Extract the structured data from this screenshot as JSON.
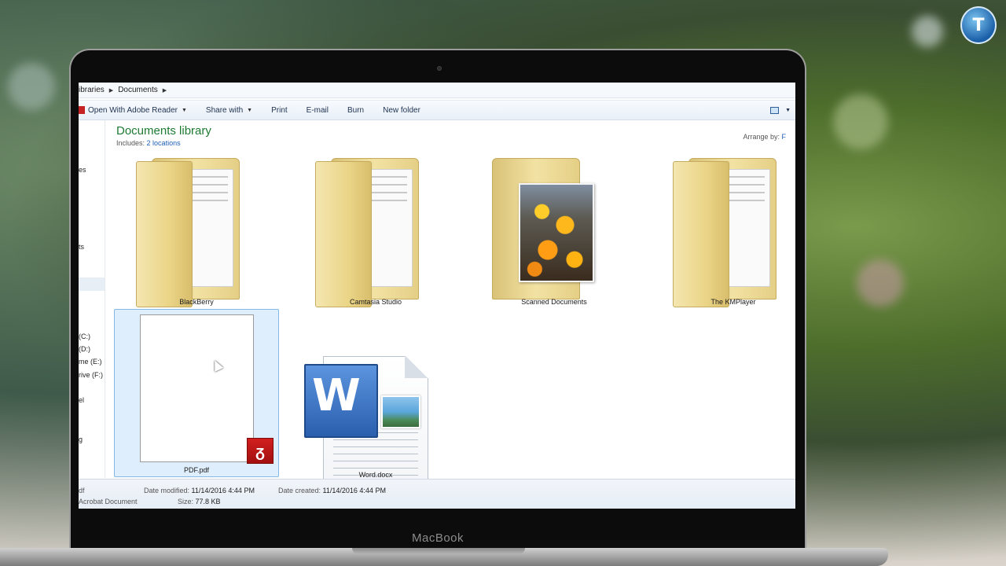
{
  "address": {
    "crumbs": [
      "ibraries",
      "Documents"
    ]
  },
  "toolbar": {
    "open_with": "Open With Adobe Reader",
    "share_with": "Share with",
    "print": "Print",
    "email": "E-mail",
    "burn": "Burn",
    "new_folder": "New folder"
  },
  "library": {
    "title": "Documents library",
    "includes_label": "Includes:",
    "includes_link": "2 locations",
    "arrange_label": "Arrange by:",
    "arrange_value": "F"
  },
  "sidebar": {
    "items": [
      "es",
      "ts",
      "(C:)",
      "(D:)",
      "me (E:)",
      "rive (F:)",
      "el",
      "g"
    ]
  },
  "items": [
    {
      "name": "BlackBerry",
      "kind": "folder"
    },
    {
      "name": "Camtasia Studio",
      "kind": "folder"
    },
    {
      "name": "Scanned Documents",
      "kind": "folder"
    },
    {
      "name": "The KMPlayer",
      "kind": "folder"
    },
    {
      "name": "PDF.pdf",
      "kind": "pdf"
    },
    {
      "name": "Word.docx",
      "kind": "docx"
    }
  ],
  "status": {
    "filename_tail": "df",
    "filetype": "Acrobat Document",
    "modified_label": "Date modified:",
    "modified_value": "11/14/2016 4:44 PM",
    "size_label": "Size:",
    "size_value": "77.8 KB",
    "created_label": "Date created:",
    "created_value": "11/14/2016 4:44 PM"
  },
  "laptop": {
    "brand": "MacBook"
  },
  "corner_logo": {
    "text": "T"
  },
  "colors": {
    "library_title": "#1e7a32",
    "link": "#1f5fb5",
    "selection": "#dfeefc",
    "pdf_red": "#c62222",
    "word_blue": "#2a5fae"
  }
}
